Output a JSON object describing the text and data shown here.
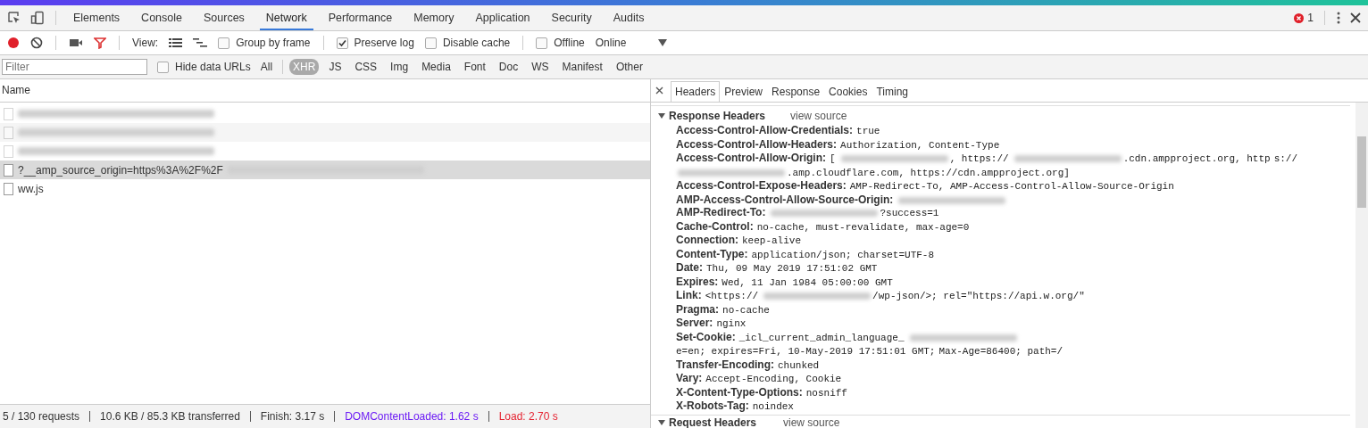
{
  "main_tabs": [
    {
      "label": "Elements",
      "selected": false
    },
    {
      "label": "Console",
      "selected": false
    },
    {
      "label": "Sources",
      "selected": false
    },
    {
      "label": "Network",
      "selected": true
    },
    {
      "label": "Performance",
      "selected": false
    },
    {
      "label": "Memory",
      "selected": false
    },
    {
      "label": "Application",
      "selected": false
    },
    {
      "label": "Security",
      "selected": false
    },
    {
      "label": "Audits",
      "selected": false
    }
  ],
  "error_count": "1",
  "toolbar": {
    "recording": true,
    "view_label": "View:",
    "options": [
      {
        "label": "Group by frame",
        "checked": false
      },
      {
        "label": "Preserve log",
        "checked": true
      },
      {
        "label": "Disable cache",
        "checked": false
      },
      {
        "label": "Offline",
        "checked": false
      }
    ],
    "throttling": "Online"
  },
  "filter": {
    "placeholder": "Filter",
    "hide_data_urls": {
      "label": "Hide data URLs",
      "checked": false
    },
    "types": [
      {
        "label": "All",
        "selected": false
      },
      {
        "label": "XHR",
        "selected": true
      },
      {
        "label": "JS",
        "selected": false
      },
      {
        "label": "CSS",
        "selected": false
      },
      {
        "label": "Img",
        "selected": false
      },
      {
        "label": "Media",
        "selected": false
      },
      {
        "label": "Font",
        "selected": false
      },
      {
        "label": "Doc",
        "selected": false
      },
      {
        "label": "WS",
        "selected": false
      },
      {
        "label": "Manifest",
        "selected": false
      },
      {
        "label": "Other",
        "selected": false
      }
    ]
  },
  "requests": {
    "column": "Name",
    "rows": [
      {
        "segments": [
          {
            "kind": "redacted"
          }
        ],
        "selected": false,
        "faded": true
      },
      {
        "segments": [
          {
            "kind": "redacted"
          }
        ],
        "selected": false,
        "faded": true
      },
      {
        "segments": [
          {
            "kind": "redacted"
          }
        ],
        "selected": false,
        "faded": true
      },
      {
        "segments": [
          {
            "kind": "text",
            "text": "?__amp_source_origin=https%3A%2F%2F"
          },
          {
            "kind": "redacted"
          }
        ],
        "selected": true,
        "faded": false
      },
      {
        "segments": [
          {
            "kind": "text",
            "text": "ww.js"
          }
        ],
        "selected": false,
        "faded": false
      }
    ]
  },
  "status_bar": [
    {
      "text": "5 / 130 requests",
      "kind": "plain"
    },
    {
      "text": "10.6 KB / 85.3 KB transferred",
      "kind": "plain"
    },
    {
      "text": "Finish: 3.17 s",
      "kind": "plain"
    },
    {
      "text": "DOMContentLoaded: 1.62 s",
      "kind": "dom"
    },
    {
      "text": "Load: 2.70 s",
      "kind": "load"
    }
  ],
  "detail_tabs": [
    {
      "label": "Headers",
      "selected": true
    },
    {
      "label": "Preview",
      "selected": false
    },
    {
      "label": "Response",
      "selected": false
    },
    {
      "label": "Cookies",
      "selected": false
    },
    {
      "label": "Timing",
      "selected": false
    }
  ],
  "response_headers": {
    "title": "Response Headers",
    "link": "view source",
    "expanded": true,
    "items": [
      {
        "name": "Access-Control-Allow-Credentials:",
        "value": [
          {
            "kind": "text",
            "text": "true"
          }
        ]
      },
      {
        "name": "Access-Control-Allow-Headers:",
        "value": [
          {
            "kind": "text",
            "text": "Authorization, Content-Type"
          }
        ]
      },
      {
        "name": "Access-Control-Allow-Origin:",
        "value": [
          {
            "kind": "text",
            "text": "["
          },
          {
            "kind": "redacted"
          },
          {
            "kind": "text",
            "text": ", https://"
          },
          {
            "kind": "redacted"
          },
          {
            "kind": "text",
            "text": ".cdn.ampproject.org, http"
          },
          {
            "kind": "text",
            "text": "s://"
          },
          {
            "kind": "redacted"
          },
          {
            "kind": "text",
            "text": ".amp.cloudflare.com, https://cdn.ampproject.org]"
          }
        ]
      },
      {
        "name": "Access-Control-Expose-Headers:",
        "value": [
          {
            "kind": "text",
            "text": "AMP-Redirect-To, AMP-Access-Control-Allow-Source-Origin"
          }
        ]
      },
      {
        "name": "AMP-Access-Control-Allow-Source-Origin:",
        "value": [
          {
            "kind": "redacted"
          }
        ]
      },
      {
        "name": "AMP-Redirect-To:",
        "value": [
          {
            "kind": "redacted"
          },
          {
            "kind": "text",
            "text": "?success=1"
          }
        ]
      },
      {
        "name": "Cache-Control:",
        "value": [
          {
            "kind": "text",
            "text": "no-cache, must-revalidate, max-age=0"
          }
        ]
      },
      {
        "name": "Connection:",
        "value": [
          {
            "kind": "text",
            "text": "keep-alive"
          }
        ]
      },
      {
        "name": "Content-Type:",
        "value": [
          {
            "kind": "text",
            "text": "application/json; charset=UTF-8"
          }
        ]
      },
      {
        "name": "Date:",
        "value": [
          {
            "kind": "text",
            "text": "Thu, 09 May 2019 17:51:02 GMT"
          }
        ]
      },
      {
        "name": "Expires:",
        "value": [
          {
            "kind": "text",
            "text": "Wed, 11 Jan 1984 05:00:00 GMT"
          }
        ]
      },
      {
        "name": "Link:",
        "value": [
          {
            "kind": "text",
            "text": "<https://"
          },
          {
            "kind": "redacted"
          },
          {
            "kind": "text",
            "text": "/wp-json/>; rel=\"https://api.w.org/\""
          }
        ]
      },
      {
        "name": "Pragma:",
        "value": [
          {
            "kind": "text",
            "text": "no-cache"
          }
        ]
      },
      {
        "name": "Server:",
        "value": [
          {
            "kind": "text",
            "text": "nginx"
          }
        ]
      },
      {
        "name": "Set-Cookie:",
        "value": [
          {
            "kind": "text",
            "text": "_icl_current_admin_language_"
          },
          {
            "kind": "redacted"
          },
          {
            "kind": "text",
            "text": "e=en; expires=Fri, 10-May-2019 17:51:01 GMT;"
          },
          {
            "kind": "text",
            "text": "Max-Age=86400; path=/"
          }
        ]
      },
      {
        "name": "Transfer-Encoding:",
        "value": [
          {
            "kind": "text",
            "text": "chunked"
          }
        ]
      },
      {
        "name": "Vary:",
        "value": [
          {
            "kind": "text",
            "text": "Accept-Encoding, Cookie"
          }
        ]
      },
      {
        "name": "X-Content-Type-Options:",
        "value": [
          {
            "kind": "text",
            "text": "nosniff"
          }
        ]
      },
      {
        "name": "X-Robots-Tag:",
        "value": [
          {
            "kind": "text",
            "text": "noindex"
          }
        ]
      }
    ]
  },
  "request_headers": {
    "title": "Request Headers",
    "link": "view source",
    "expanded": true
  }
}
